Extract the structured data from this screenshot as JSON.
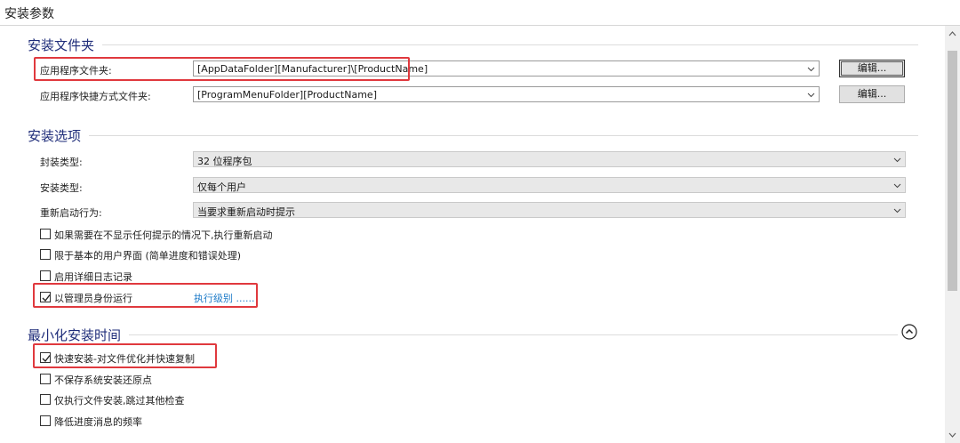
{
  "window": {
    "title": "安装参数"
  },
  "install_folders": {
    "title": "安装文件夹",
    "app_folder": {
      "label": "应用程序文件夹:",
      "value": "[AppDataFolder][Manufacturer]\\[ProductName]",
      "edit_label": "编辑..."
    },
    "shortcut_folder": {
      "label": "应用程序快捷方式文件夹:",
      "value": "[ProgramMenuFolder][ProductName]",
      "edit_label": "编辑..."
    }
  },
  "install_options": {
    "title": "安装选项",
    "package_type": {
      "label": "封装类型:",
      "value": "32 位程序包"
    },
    "install_type": {
      "label": "安装类型:",
      "value": "仅每个用户"
    },
    "restart_behavior": {
      "label": "重新启动行为:",
      "value": "当要求重新启动时提示"
    },
    "checkboxes": [
      {
        "label": "如果需要在不显示任何提示的情况下,执行重新启动",
        "checked": false
      },
      {
        "label": "限于基本的用户界面 (简单进度和错误处理)",
        "checked": false
      },
      {
        "label": "启用详细日志记录",
        "checked": false
      },
      {
        "label": "以管理员身份运行",
        "checked": true
      }
    ],
    "exec_level_link": "执行级别 ......"
  },
  "minimize_time": {
    "title": "最小化安装时间",
    "checkboxes": [
      {
        "label": "快速安装-对文件优化并快速复制",
        "checked": true
      },
      {
        "label": "不保存系统安装还原点",
        "checked": false
      },
      {
        "label": "仅执行文件安装,跳过其他检查",
        "checked": false
      },
      {
        "label": "降低进度消息的频率",
        "checked": false
      }
    ]
  },
  "colors": {
    "section_title": "#1f2d7a",
    "highlight_box": "#e0393e",
    "link": "#1e7bc8"
  }
}
